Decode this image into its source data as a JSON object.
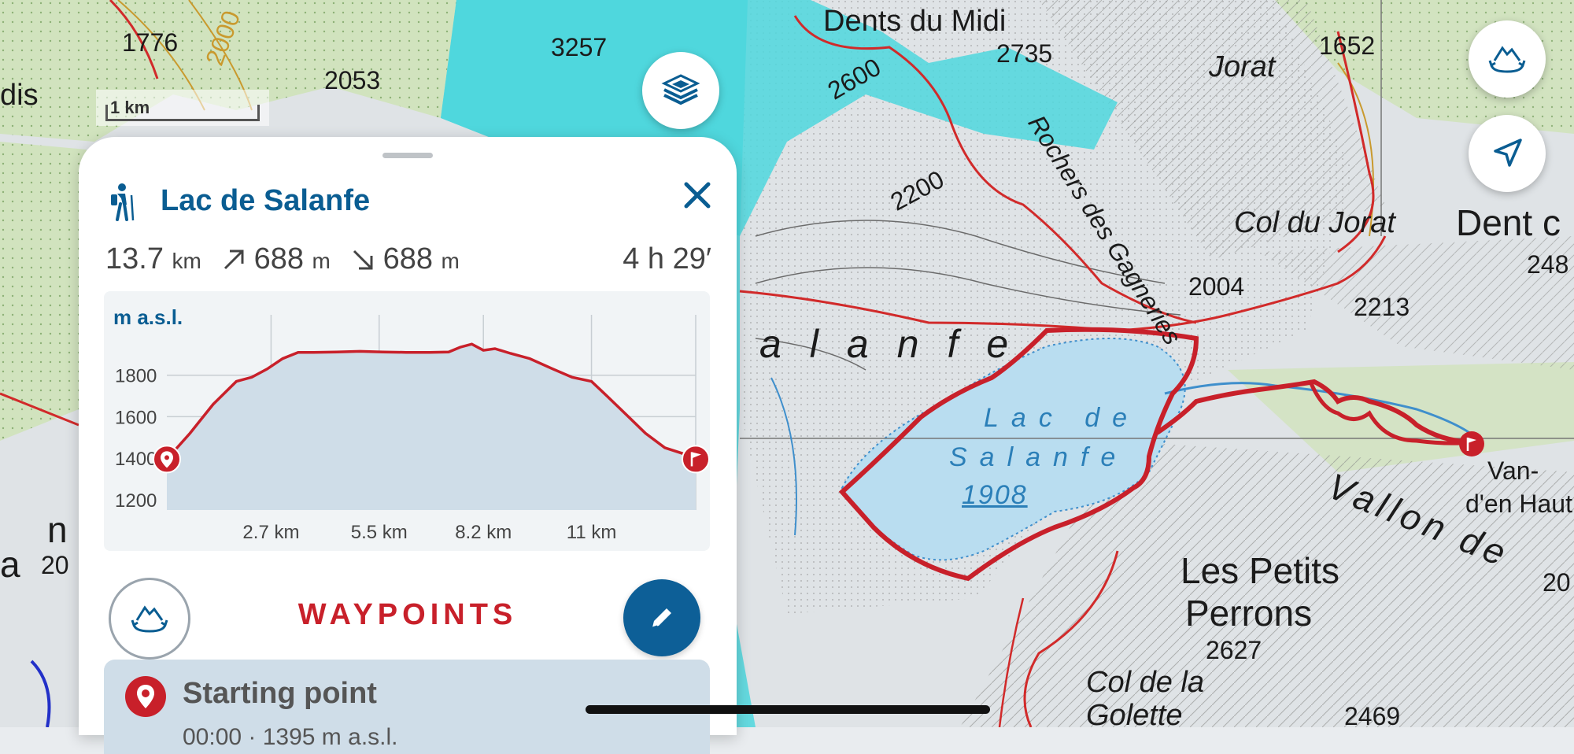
{
  "map": {
    "scale_label": "1 km",
    "labels": {
      "dents_du_midi": "Dents du Midi",
      "jorat": "Jorat",
      "col_du_jorat": "Col du Jorat",
      "dent_partial": "Dent c",
      "rochers_des_gagneries": "Rochers des Gagneries",
      "salanfe": "alanfe",
      "lake_line1": "Lac de",
      "lake_line2": "Salanfe",
      "lake_elev": "1908",
      "les_petits_perrons_1": "Les Petits",
      "les_petits_perrons_2": "Perrons",
      "col_de_la_golette_1": "Col de la",
      "col_de_la_golette_2": "Golette",
      "vallon_de": "Vallon de",
      "van_1": "Van-",
      "van_2": "d'en Haut",
      "dis_partial": "dis",
      "a_partial": "a",
      "n_partial": "n"
    },
    "elevations": [
      "1776",
      "2000",
      "2053",
      "3257",
      "2735",
      "2600",
      "2200",
      "2004",
      "2213",
      "248",
      "1652",
      "2627",
      "2469",
      "20",
      "20"
    ]
  },
  "panel": {
    "title": "Lac de Salanfe",
    "distance_value": "13.7",
    "distance_unit": "km",
    "ascent_value": "688",
    "ascent_unit": "m",
    "descent_value": "688",
    "descent_unit": "m",
    "duration": "4 h 29′",
    "waypoints_heading": "WAYPOINTS",
    "waypoint_first_name": "Starting point",
    "waypoint_first_sub": "00:00 · 1395 m a.s.l."
  },
  "chart_data": {
    "type": "area",
    "ylabel": "m a.s.l.",
    "x_tick_labels": [
      "2.7 km",
      "5.5 km",
      "8.2 km",
      "11 km"
    ],
    "x_ticks": [
      2.7,
      5.5,
      8.2,
      11
    ],
    "y_ticks": [
      1200,
      1400,
      1600,
      1800
    ],
    "y_tick_labels": [
      "1200",
      "1400",
      "1600",
      "1800"
    ],
    "xlim": [
      0,
      13.7
    ],
    "ylim": [
      1150,
      2000
    ],
    "grid": true,
    "x": [
      0,
      0.6,
      1.2,
      1.8,
      2.2,
      2.6,
      3.0,
      3.4,
      3.8,
      4.4,
      5.0,
      5.6,
      6.2,
      6.8,
      7.3,
      7.6,
      7.9,
      8.2,
      8.5,
      8.9,
      9.4,
      10.0,
      10.5,
      11.0,
      11.4,
      11.9,
      12.4,
      12.9,
      13.4,
      13.7
    ],
    "y": [
      1395,
      1520,
      1660,
      1770,
      1790,
      1830,
      1880,
      1910,
      1910,
      1912,
      1915,
      1912,
      1910,
      1910,
      1912,
      1935,
      1950,
      1920,
      1928,
      1905,
      1880,
      1830,
      1790,
      1770,
      1700,
      1610,
      1520,
      1450,
      1420,
      1395
    ],
    "start_marker": "start-pin",
    "end_marker": "finish-flag"
  },
  "colors": {
    "brand_blue": "#0a5d92",
    "route_red": "#c8202a",
    "lake": "#b9ddf0",
    "glacier": "#4fd7dd"
  },
  "icons": [
    "layers-icon",
    "3d-view-icon",
    "locate-icon",
    "hiker-icon",
    "close-icon",
    "edit-icon",
    "waypoint-pin-icon",
    "start-pin-icon",
    "finish-flag-icon"
  ]
}
